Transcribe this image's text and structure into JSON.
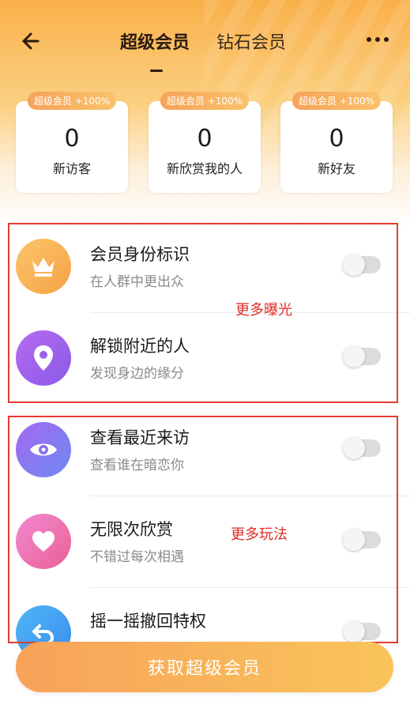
{
  "header": {
    "tabs": [
      {
        "label": "超级会员",
        "active": true
      },
      {
        "label": "钻石会员",
        "active": false
      }
    ]
  },
  "stats": [
    {
      "badge": "超级会员 +100%",
      "value": "0",
      "label": "新访客"
    },
    {
      "badge": "超级会员 +100%",
      "value": "0",
      "label": "新欣赏我的人"
    },
    {
      "badge": "超级会员 +100%",
      "value": "0",
      "label": "新好友"
    }
  ],
  "sections": [
    {
      "label": "更多曝光"
    },
    {
      "label": "更多玩法"
    }
  ],
  "features": [
    {
      "title": "会员身份标识",
      "subtitle": "在人群中更出众",
      "icon": "crown-icon",
      "toggle": "off"
    },
    {
      "title": "解锁附近的人",
      "subtitle": "发现身边的缘分",
      "icon": "location-pin-icon",
      "toggle": "off"
    },
    {
      "title": "查看最近来访",
      "subtitle": "查看谁在暗恋你",
      "icon": "eye-icon",
      "toggle": "off"
    },
    {
      "title": "无限次欣赏",
      "subtitle": "不错过每次相遇",
      "icon": "heart-icon",
      "toggle": "off"
    },
    {
      "title": "摇一摇撤回特权",
      "subtitle": "",
      "icon": "undo-icon",
      "toggle": "off"
    }
  ],
  "cta": {
    "label": "获取超级会员"
  },
  "colors": {
    "accent_orange": "#f8a25a",
    "annotation_red": "#e53b2f"
  }
}
